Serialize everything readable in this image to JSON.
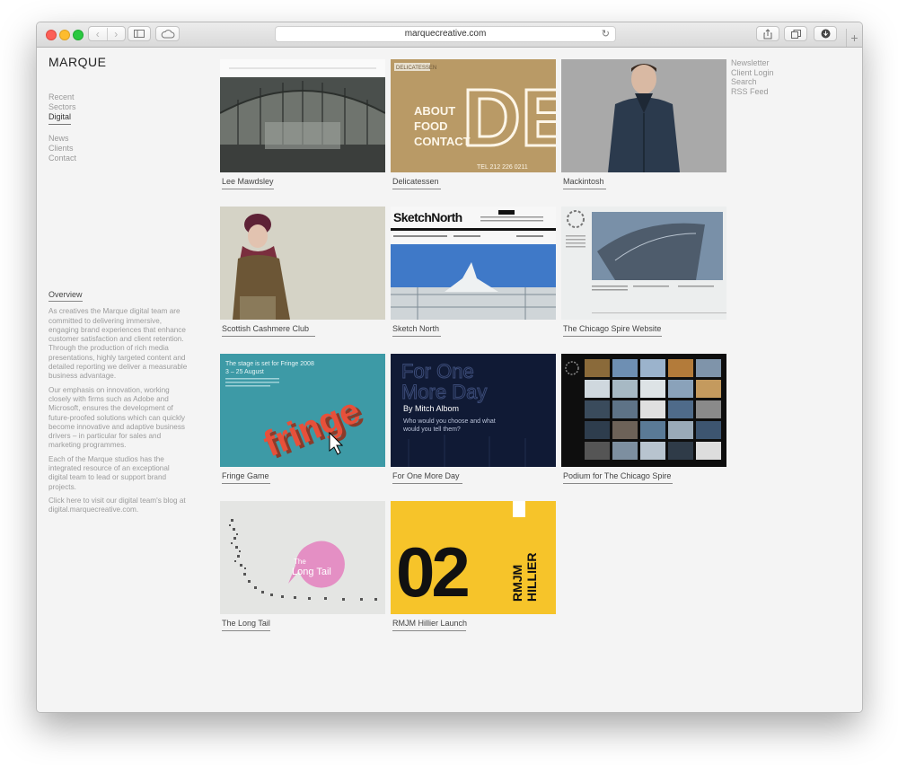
{
  "browser": {
    "url": "marquecreative.com",
    "back_glyph": "‹",
    "forward_glyph": "›",
    "add_tab_glyph": "+"
  },
  "site": {
    "logo": "MARQUE",
    "left_nav": {
      "items": [
        "Recent",
        "Sectors",
        "Digital"
      ],
      "secondary": [
        "News",
        "Clients",
        "Contact"
      ]
    },
    "right_nav": [
      "Newsletter",
      "Client Login",
      "Search",
      "RSS Feed"
    ],
    "overview": {
      "title": "Overview",
      "paragraphs": [
        "As creatives the Marque digital team are committed to delivering immersive, engaging brand experiences that enhance customer satisfaction and client retention. Through the production of rich media presentations, highly targeted content and detailed reporting we deliver a measurable business advantage.",
        "Our emphasis on innovation, working closely with firms such as Adobe and Microsoft, ensures the development of future-proofed solutions which can quickly become innovative and adaptive business drivers – in particular for sales and marketing programmes.",
        "Each of the Marque studios has the integrated resource of an exceptional digital team to lead or support brand projects.",
        "Click here to visit our digital team's blog at digital.marquecreative.com."
      ]
    },
    "projects": [
      {
        "label": "Lee Mawdsley"
      },
      {
        "label": "Delicatessen",
        "art": {
          "line1": "DELICATESSEN",
          "line2": "ABOUT",
          "line3": "FOOD",
          "line4": "CONTACT",
          "phone": "TEL 212 226 0211",
          "big": "DEL"
        }
      },
      {
        "label": "Mackintosh"
      },
      {
        "label": "Scottish Cashmere Club"
      },
      {
        "label": "Sketch North",
        "art": {
          "title": "SketchNorth"
        }
      },
      {
        "label": "The Chicago Spire Website"
      },
      {
        "label": "Fringe Game",
        "art": {
          "headline": "The stage is set for Fringe 2008",
          "dates": "3 – 25 August",
          "word": "fringe"
        }
      },
      {
        "label": "For One More Day",
        "art": {
          "title1": "For One",
          "title2": "More Day",
          "author": "By Mitch Albom",
          "question1": "Who would you choose and what",
          "question2": "would you tell them?"
        }
      },
      {
        "label": "Podium for The Chicago Spire"
      },
      {
        "label": "The Long Tail",
        "art": {
          "the": "The",
          "long": "Long Tail"
        }
      },
      {
        "label": "RMJM Hillier Launch",
        "art": {
          "number": "02",
          "rmjm": "RMJM",
          "hillier": "HILLIER"
        }
      }
    ]
  },
  "colors": {
    "page_bg": "#f4f4f4",
    "fringe_teal": "#3d9aa6",
    "rmjm_yellow": "#f6c42a",
    "long_tail_pink": "#e48fc4",
    "deli_kraft": "#b99a66"
  }
}
